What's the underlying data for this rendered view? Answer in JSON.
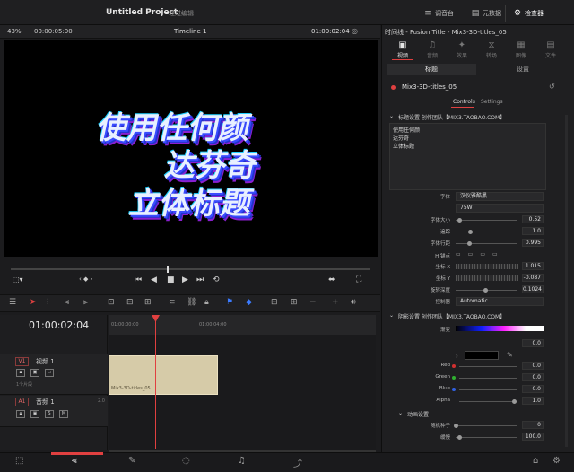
{
  "app": {
    "project_title": "Untitled Project",
    "mode_label": "轻过编辑",
    "top_buttons": {
      "mixer": "调音台",
      "metadata": "元数据",
      "inspector": "检查器"
    }
  },
  "viewer": {
    "zoom": "43%",
    "timecode": "00:00:05:00",
    "timeline_name": "Timeline 1",
    "current_tc": "01:00:02:04",
    "title_lines": [
      "使用任何颜",
      "达芬奇",
      "立体标题"
    ]
  },
  "timeline": {
    "timecode": "01:00:02:04",
    "ruler_labels": [
      "01:00:00:00",
      "01:00:04:00"
    ],
    "tracks": {
      "v1": {
        "badge": "V1",
        "name": "视频 1",
        "clip_count": "1个片段"
      },
      "a1": {
        "badge": "A1",
        "name": "音频 1",
        "level": "2.0",
        "s": "S",
        "m": "M"
      }
    },
    "clip_name": "Mix3-3D-titles_05"
  },
  "inspector": {
    "header": "时间线 - Fusion Title - Mix3-3D-titles_05",
    "tabs": [
      {
        "label": "视频",
        "icon": "film-icon"
      },
      {
        "label": "音频",
        "icon": "music-icon"
      },
      {
        "label": "效果",
        "icon": "fx-icon"
      },
      {
        "label": "转场",
        "icon": "transition-icon"
      },
      {
        "label": "图像",
        "icon": "image-icon"
      },
      {
        "label": "文件",
        "icon": "file-icon"
      }
    ],
    "sub_tabs": {
      "title": "标题",
      "settings": "设置"
    },
    "node_name": "Mix3-3D-titles_05",
    "controls_tab": "Controls",
    "settings_tab": "Settings",
    "section1": "标题设置 创作团队【MIX3.TAOBAO.COM】",
    "text_content": [
      "使用任何颜",
      "达芬奇",
      "立体标题"
    ],
    "params": {
      "font_label": "字体",
      "font_value": "汉仪雅酷黑",
      "weight_value": "75W",
      "size_label": "字体大小",
      "size_value": "0.52",
      "tracking_label": "追踪",
      "tracking_value": "1.0",
      "line_spacing_label": "字体行距",
      "line_spacing_value": "0.995",
      "anchor_label": "H 锚点",
      "posx_label": "坐标 X",
      "posx_value": "1.015",
      "posy_label": "坐标 Y",
      "posy_value": "-0.087",
      "rotation_label": "旋转深度",
      "rotation_value": "0.1024",
      "auto_label": "控制器",
      "auto_value": "Automatic"
    },
    "section2": "阴影设置 创作团队【MIX3.TAOBAO.COM】",
    "shadow": {
      "gradient_label": "渐变",
      "gradient_value": "0.0",
      "red_label": "Red",
      "red_value": "0.0",
      "green_label": "Green",
      "green_value": "0.0",
      "blue_label": "Blue",
      "blue_value": "0.0",
      "alpha_label": "Alpha",
      "alpha_value": "1.0"
    },
    "section3": "动画设置",
    "anim": {
      "seed_label": "随机种子",
      "seed_value": "0",
      "speed_label": "缓慢",
      "speed_value": "100.0"
    }
  },
  "colors": {
    "accent": "#e04040",
    "clip": "#d6cba8",
    "background": "#1c1c1e"
  }
}
